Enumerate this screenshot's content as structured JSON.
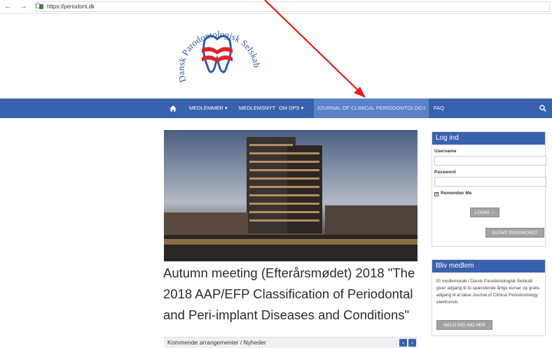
{
  "browser": {
    "url": "https://periodont.dk"
  },
  "logo": {
    "text_arc": "Dansk Parodontologisk Selskab"
  },
  "nav": {
    "items": [
      {
        "label": "MEDLEMMER ▾"
      },
      {
        "label": "MEDLEMSNYT"
      },
      {
        "label": "OM DPS ▾"
      },
      {
        "label": "JOURNAL OF CLINICAL PERIODONTOLOGY"
      },
      {
        "label": "FAQ"
      }
    ],
    "accent": "#3862ad"
  },
  "article": {
    "headline": "Autumn meeting (Efterårsmødet) 2018 \"The 2018 AAP/EFP Classification of Periodontal and Peri-implant Diseases and Conditions\""
  },
  "news": {
    "label": "Kommende arrangementer / Nyheder"
  },
  "login": {
    "title": "Log ind",
    "username_label": "Username",
    "password_label": "Password",
    "remember_label": "Remember Me",
    "login_button": "LOGIN →",
    "forgot_button": "GLEMT PASSWORD?"
  },
  "membership": {
    "title": "Bliv medlem",
    "text": "Et medlemskab i Dansk Parodontologisk Selskab giver adgang til to spændende årlige kurser og gratis adgang til at læse Journal of Clinical Periodontology elektronisk.",
    "button": "MELD DIG IND HER"
  }
}
